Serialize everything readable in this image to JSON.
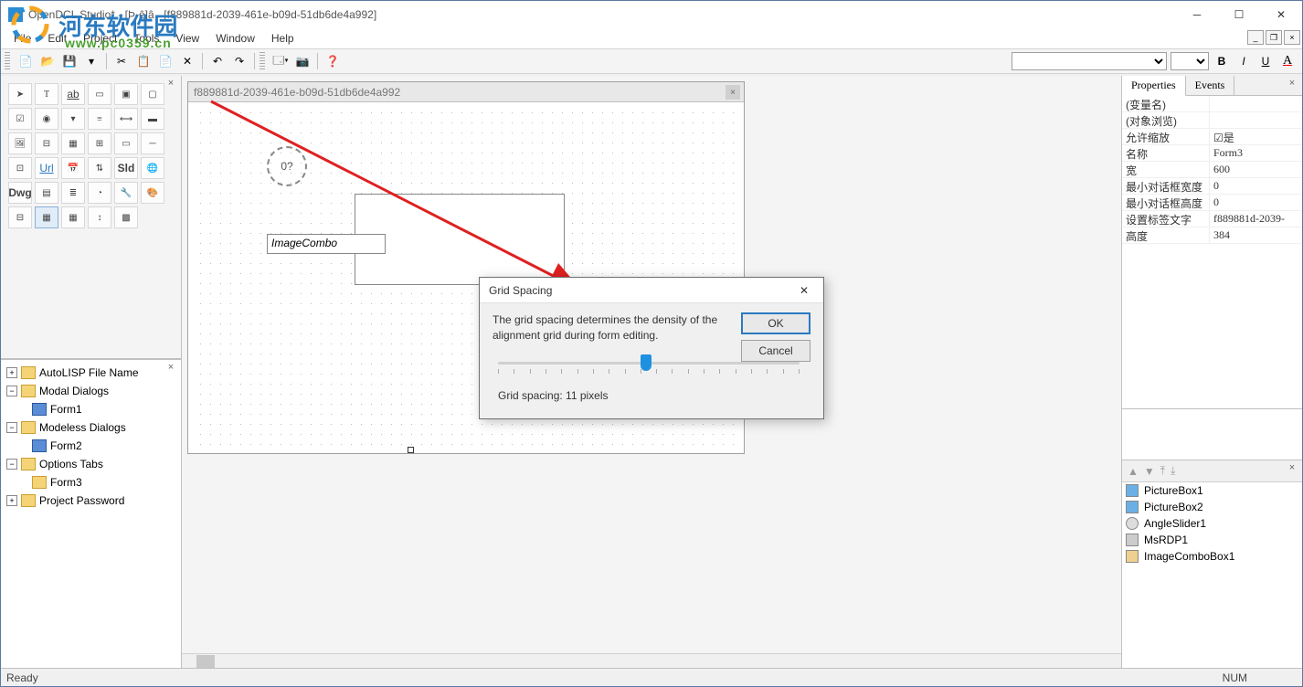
{
  "window": {
    "title": "OpenDCL Studio* - [Þ·ê]â - [f889881d-2039-461e-b09d-51db6de4a992]"
  },
  "menu": {
    "file": "File",
    "edit": "Edit",
    "project": "Project",
    "tools": "Tools",
    "view": "View",
    "window": "Window",
    "help": "Help"
  },
  "document": {
    "title": "f889881d-2039-461e-b09d-51db6de4a992"
  },
  "designer": {
    "dial_label": "0?",
    "imagecombo_label": "ImageCombo"
  },
  "dialog": {
    "title": "Grid Spacing",
    "text": "The grid spacing determines the density of the alignment grid during form editing.",
    "ok": "OK",
    "cancel": "Cancel",
    "value_label": "Grid spacing: 11 pixels"
  },
  "tree": {
    "n0": "AutoLISP File Name",
    "n1": "Modal Dialogs",
    "n1a": "Form1",
    "n2": "Modeless Dialogs",
    "n2a": "Form2",
    "n3": "Options Tabs",
    "n3a": "Form3",
    "n4": "Project Password"
  },
  "props": {
    "tab_properties": "Properties",
    "tab_events": "Events",
    "r0k": "(变量名)",
    "r0v": "",
    "r1k": "(对象浏览)",
    "r1v": "",
    "r2k": "允许缩放",
    "r2v": "☑是",
    "r3k": "名称",
    "r3v": "Form3",
    "r4k": "宽",
    "r4v": "600",
    "r5k": "最小对话框宽度",
    "r5v": "0",
    "r6k": "最小对话框高度",
    "r6v": "0",
    "r7k": "设置标签文字",
    "r7v": "f889881d-2039-",
    "r8k": "高度",
    "r8v": "384"
  },
  "zorder": {
    "i0": "PictureBox1",
    "i1": "PictureBox2",
    "i2": "AngleSlider1",
    "i3": "MsRDP1",
    "i4": "ImageComboBox1"
  },
  "status": {
    "ready": "Ready",
    "num": "NUM"
  },
  "watermark": {
    "text": "河东软件园",
    "url": "www.pc0359.cn"
  }
}
